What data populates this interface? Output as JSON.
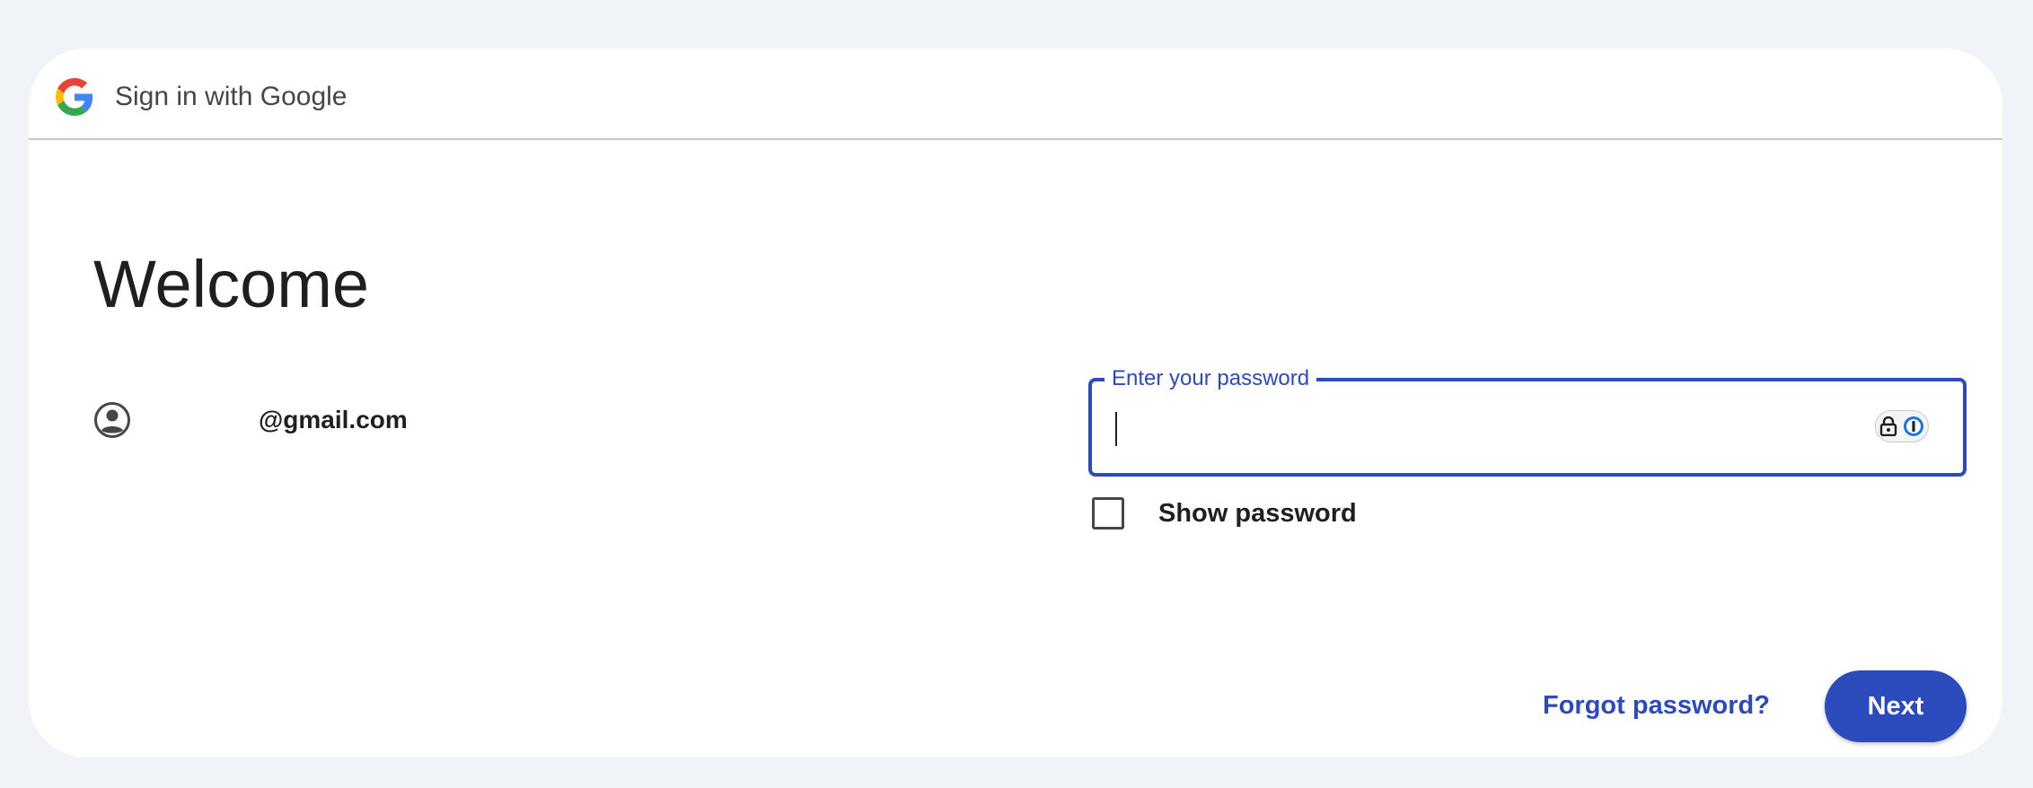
{
  "header": {
    "logo_icon": "google-g-icon",
    "title": "Sign in with Google"
  },
  "welcome": {
    "heading": "Welcome",
    "account_icon": "account-circle-icon",
    "email": "@gmail.com"
  },
  "password": {
    "label": "Enter your password",
    "value": "",
    "password_manager_icon": "password-manager-icon"
  },
  "show_password": {
    "label": "Show password",
    "checked": false
  },
  "actions": {
    "forgot_label": "Forgot password?",
    "next_label": "Next"
  },
  "colors": {
    "accent": "#2b4bbd",
    "background": "#f0f4f9",
    "card": "#ffffff",
    "text": "#1f1f1f"
  }
}
